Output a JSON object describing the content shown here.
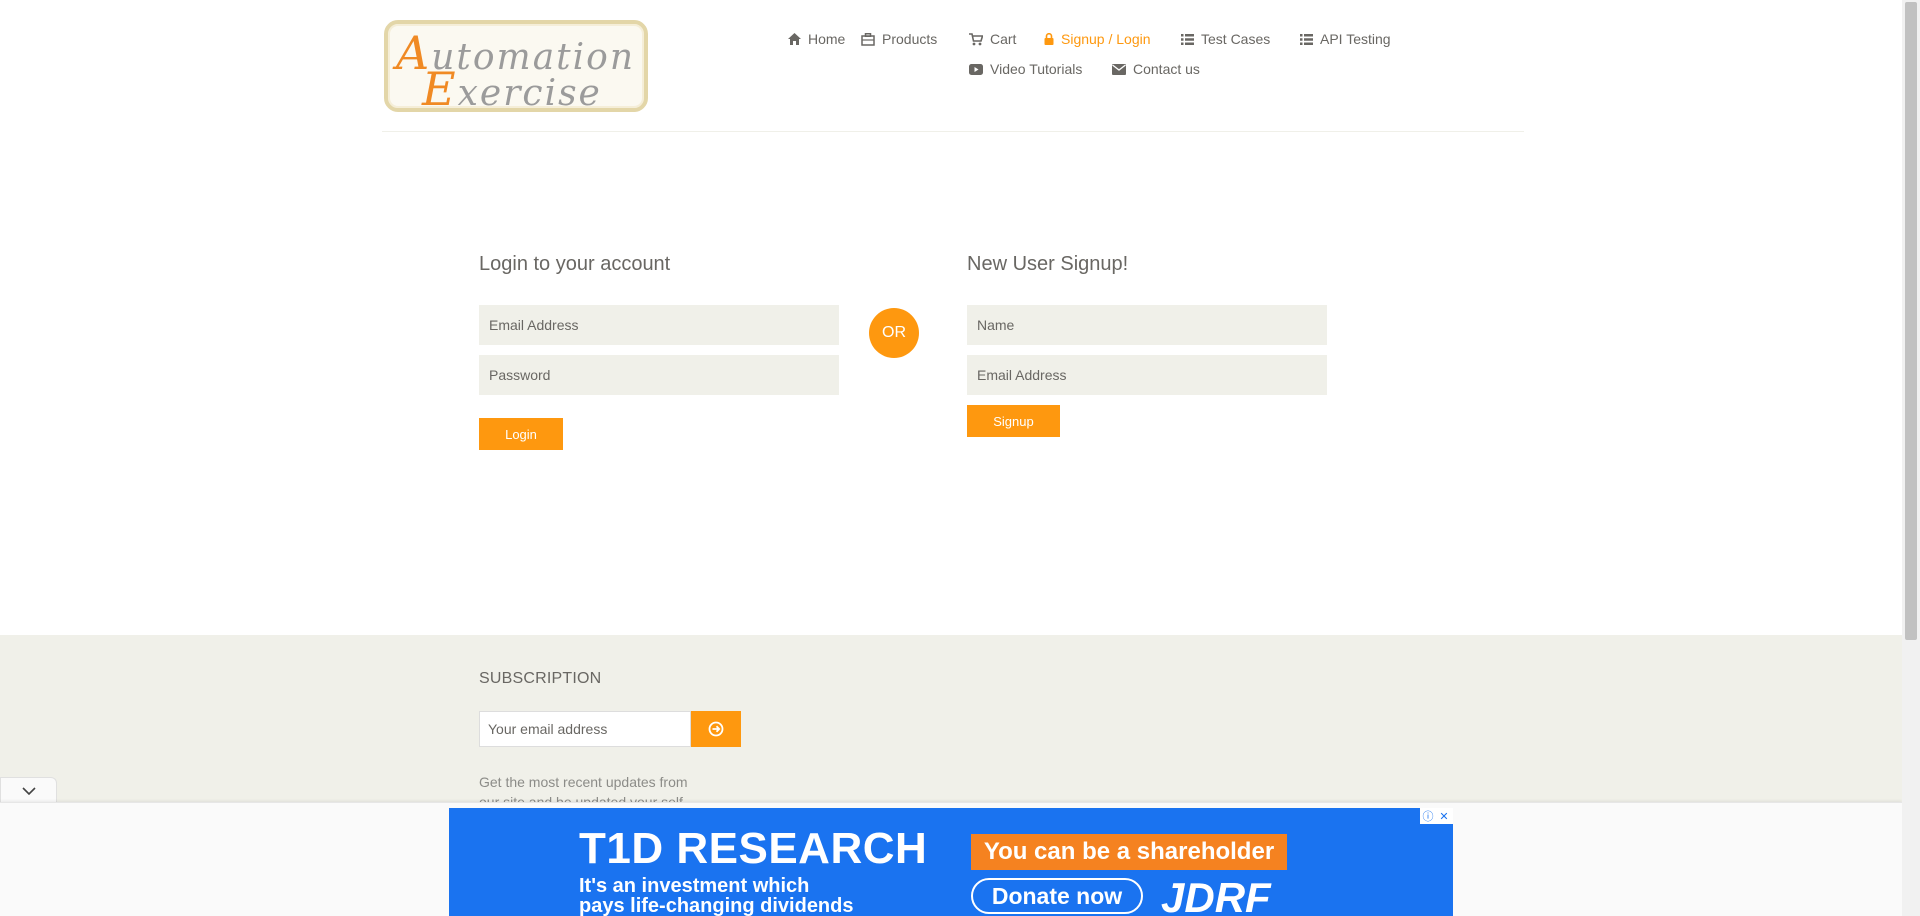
{
  "brand": {
    "logo_line1_cap": "A",
    "logo_line1_rest": "utomation",
    "logo_line2_cap": "E",
    "logo_line2_rest": "xercise"
  },
  "nav": [
    {
      "label": "Home",
      "icon": "home-icon"
    },
    {
      "label": "Products",
      "icon": "products-icon"
    },
    {
      "label": "Cart",
      "icon": "cart-icon"
    },
    {
      "label": "Signup / Login",
      "icon": "lock-icon",
      "active": true
    },
    {
      "label": "Test Cases",
      "icon": "list-icon"
    },
    {
      "label": "API Testing",
      "icon": "list-icon"
    },
    {
      "label": "Video Tutorials",
      "icon": "youtube-icon"
    },
    {
      "label": "Contact us",
      "icon": "envelope-icon"
    }
  ],
  "login": {
    "heading": "Login to your account",
    "email_placeholder": "Email Address",
    "password_placeholder": "Password",
    "button": "Login"
  },
  "or_label": "OR",
  "signup": {
    "heading": "New User Signup!",
    "name_placeholder": "Name",
    "email_placeholder": "Email Address",
    "button": "Signup"
  },
  "footer": {
    "subscription_title": "SUBSCRIPTION",
    "email_placeholder": "Your email address",
    "text": "Get the most recent updates from our site and be updated your self..."
  },
  "ad": {
    "title": "T1D RESEARCH",
    "tagline": "You can be a shareholder",
    "subtitle_line1": "It's an investment which",
    "subtitle_line2": "pays life-changing dividends",
    "donate": "Donate now",
    "brand": "JDRF"
  },
  "colors": {
    "accent": "#fe980f",
    "field_bg": "#f0f0e9",
    "text": "#696763",
    "ad_bg": "#1a73f0",
    "ad_tag": "#f58220"
  }
}
